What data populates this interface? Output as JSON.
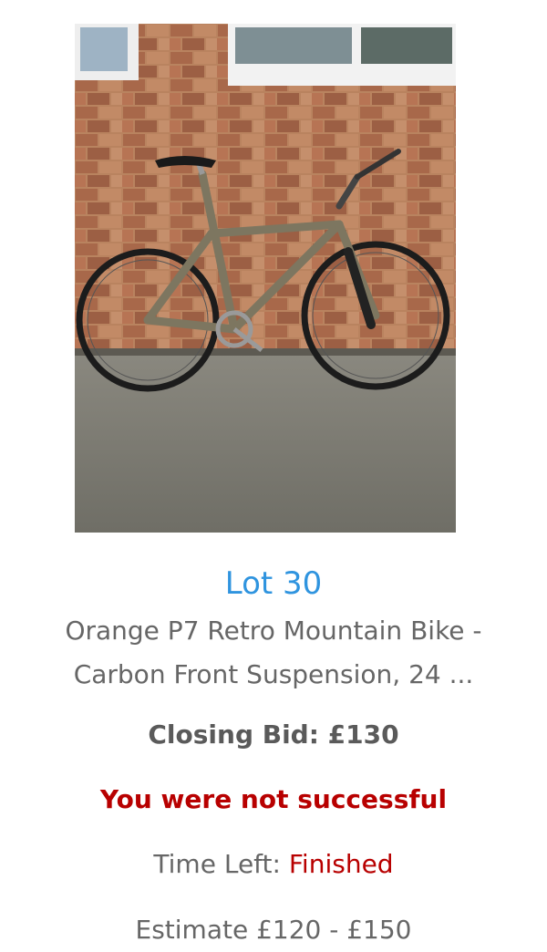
{
  "lot": {
    "number_label": "Lot 30",
    "title_line1": "Orange P7 Retro Mountain Bike -",
    "title_line2": "Carbon Front Suspension, 24 ...",
    "closing_bid": "Closing Bid: £130",
    "result_message": "You were not successful",
    "time_left_label": "Time Left:",
    "time_left_value": "Finished",
    "estimate": "Estimate £120 - £150"
  },
  "colors": {
    "link_blue": "#2f94df",
    "status_red": "#b80000",
    "text_grey": "#666666"
  }
}
